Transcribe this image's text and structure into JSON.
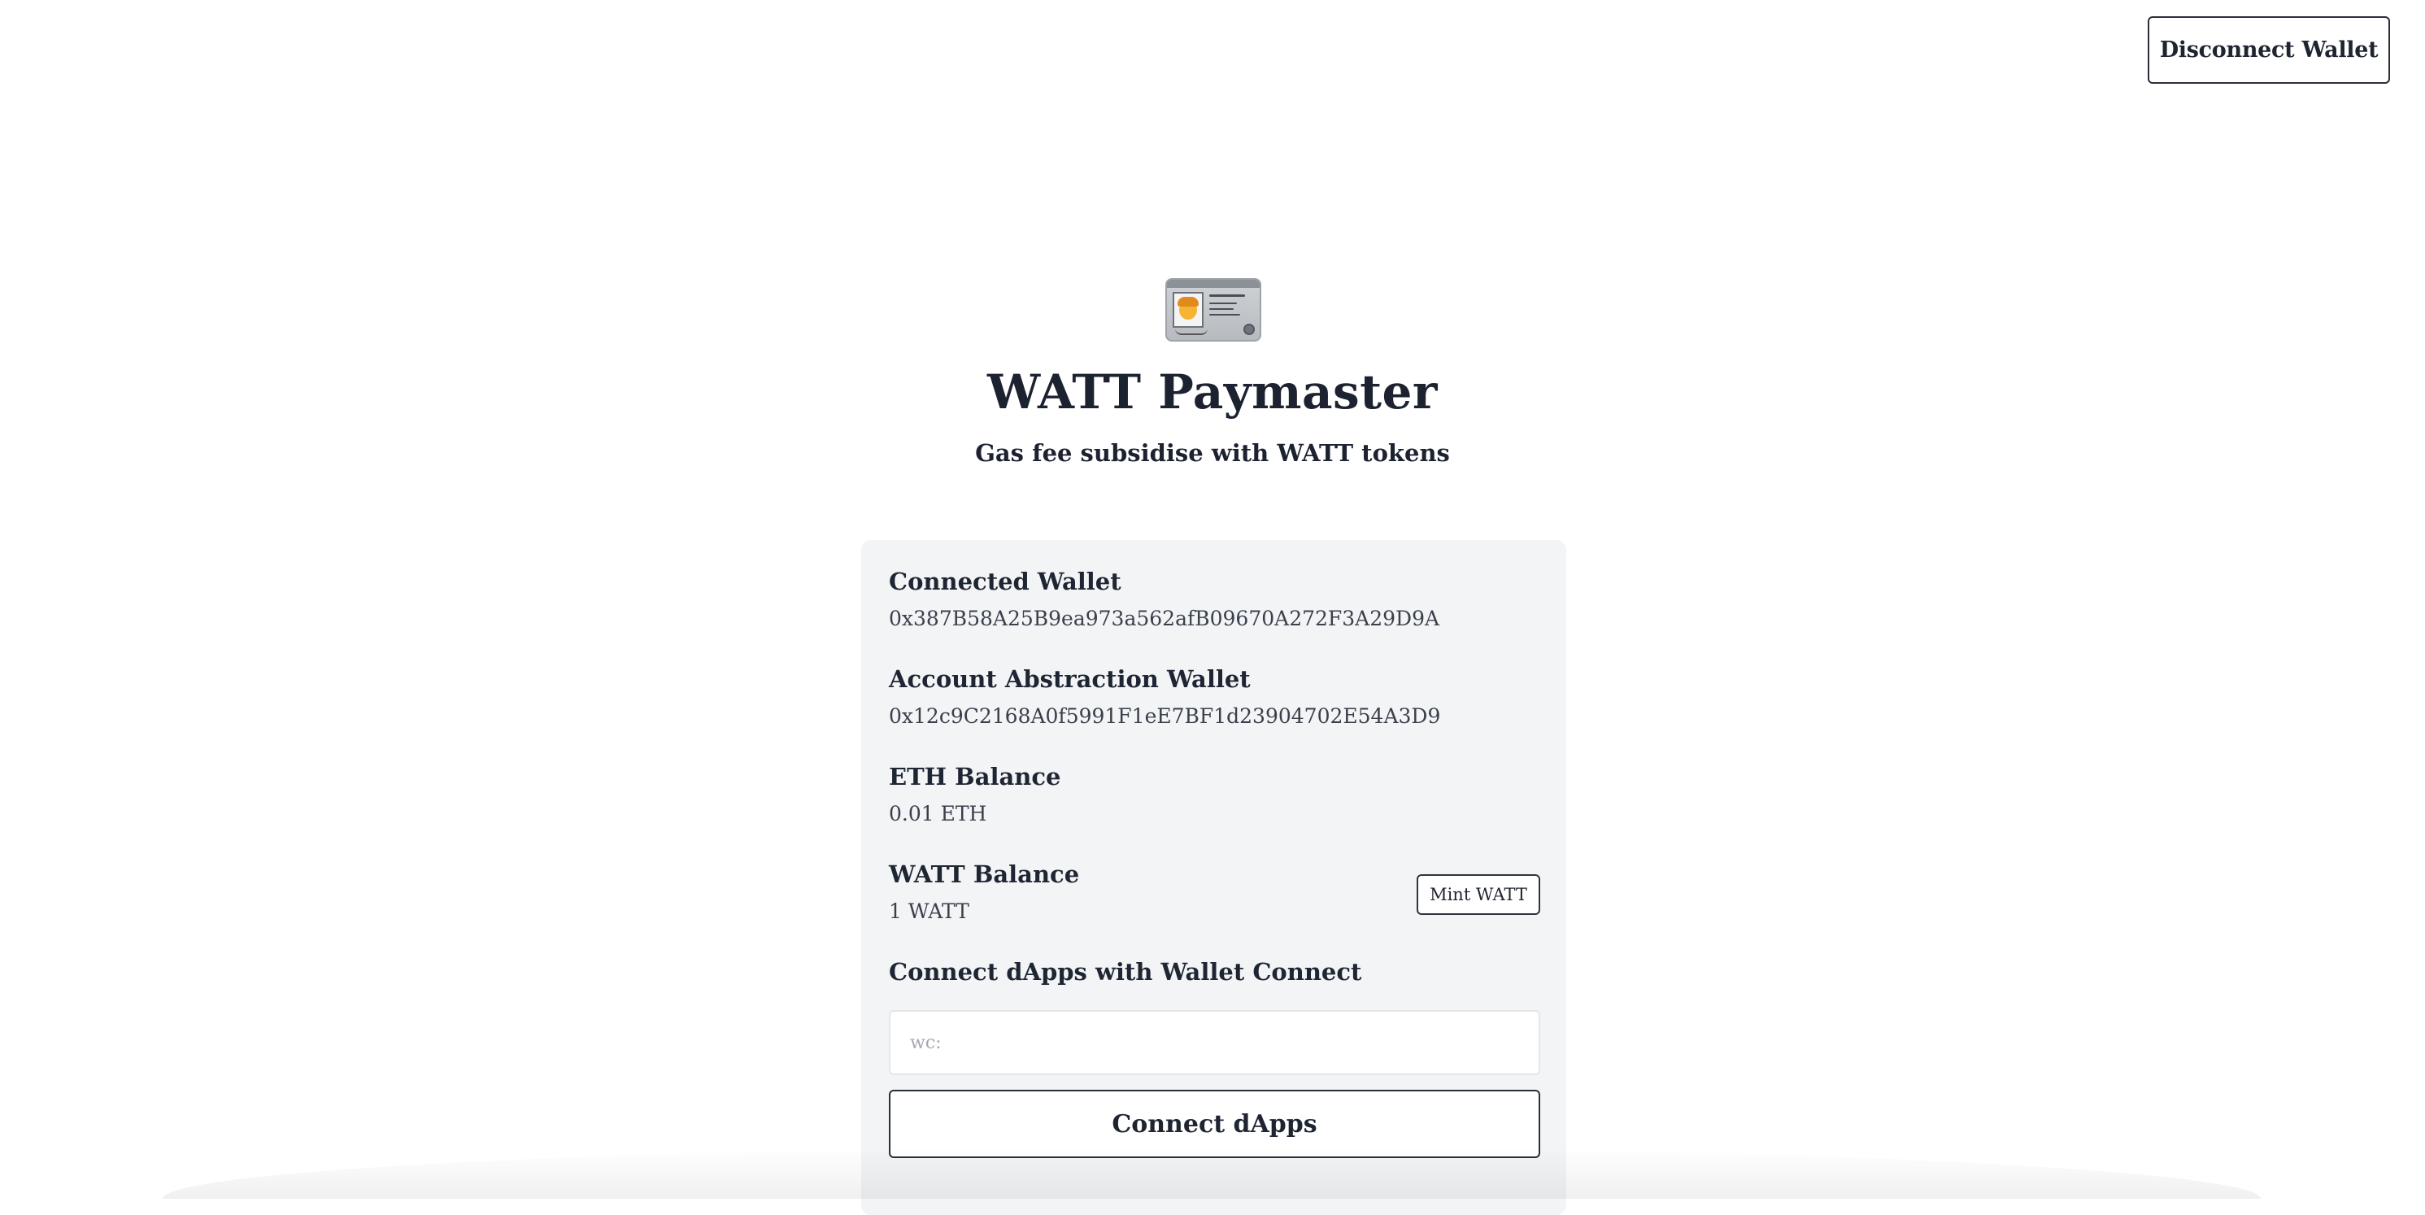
{
  "header": {
    "disconnect_label": "Disconnect Wallet"
  },
  "hero": {
    "icon": "id-card-icon",
    "title": "WATT Paymaster",
    "subtitle": "Gas fee subsidise with WATT tokens"
  },
  "panel": {
    "connected_wallet": {
      "label": "Connected Wallet",
      "value": "0x387B58A25B9ea973a562afB09670A272F3A29D9A"
    },
    "aa_wallet": {
      "label": "Account Abstraction Wallet",
      "value": "0x12c9C2168A0f5991F1eE7BF1d23904702E54A3D9"
    },
    "eth_balance": {
      "label": "ETH Balance",
      "value": "0.01 ETH"
    },
    "watt_balance": {
      "label": "WATT Balance",
      "value": "1 WATT",
      "mint_label": "Mint WATT"
    },
    "wallet_connect": {
      "label": "Connect dApps with Wallet Connect",
      "placeholder": "wc:",
      "value": "",
      "button_label": "Connect dApps"
    }
  },
  "colors": {
    "background": "#ffffff",
    "panel": "#f3f4f6",
    "text": "#1f2530",
    "border": "#2a2f3a"
  }
}
